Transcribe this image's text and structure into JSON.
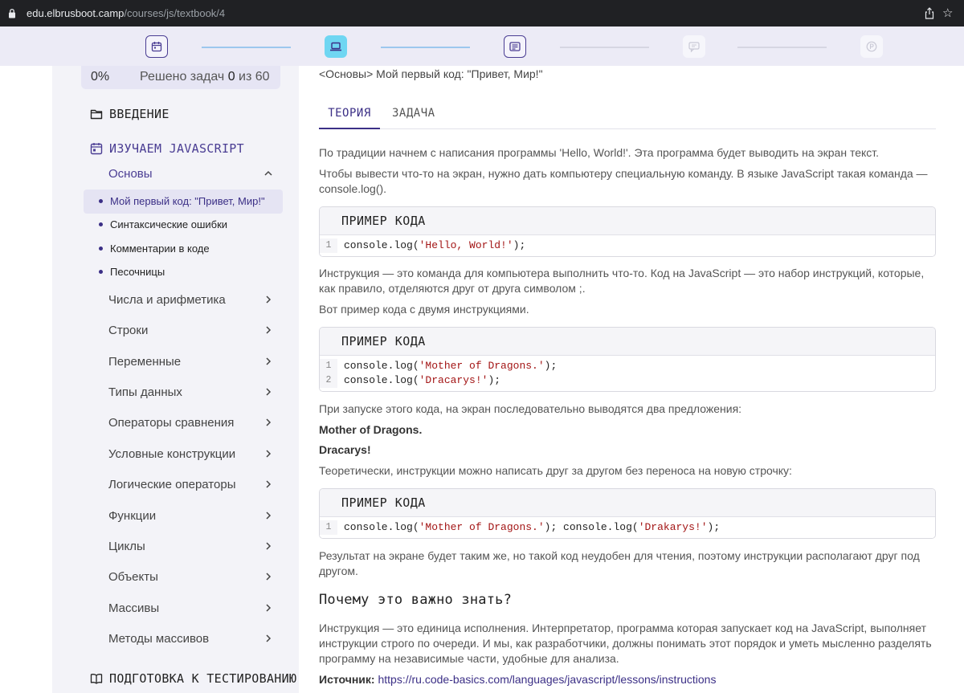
{
  "browser": {
    "url_domain": "edu.elbrusboot.camp",
    "url_path": "/courses/js/textbook/4"
  },
  "stepper": {
    "steps": [
      {
        "icon": "calendar-icon",
        "state": "done"
      },
      {
        "icon": "laptop-icon",
        "state": "active"
      },
      {
        "icon": "card-icon",
        "state": "done"
      },
      {
        "icon": "chat-icon",
        "state": "todo"
      },
      {
        "icon": "coin-icon",
        "state": "todo"
      }
    ]
  },
  "sidebar": {
    "progress": {
      "percent": "0%",
      "solved_label": "Решено задач",
      "solved_count": "0",
      "of_label": "из",
      "total": "60"
    },
    "sections": {
      "intro": "ВВЕДЕНИЕ",
      "learn_js": "ИЗУЧАЕМ JAVASCRIPT",
      "testing": "ПОДГОТОВКА К ТЕСТИРОВАНИЮ"
    },
    "current_topic": "Основы",
    "lessons": [
      "Мой первый код: \"Привет, Мир!\"",
      "Синтаксические ошибки",
      "Комментарии в коде",
      "Песочницы"
    ],
    "topics": [
      "Числа и арифметика",
      "Строки",
      "Переменные",
      "Типы данных",
      "Операторы сравнения",
      "Условные конструкции",
      "Логические операторы",
      "Функции",
      "Циклы",
      "Объекты",
      "Массивы",
      "Методы массивов"
    ]
  },
  "main": {
    "breadcrumb": "<Основы> Мой первый код: \"Привет, Мир!\"",
    "tabs": {
      "theory": "ТЕОРИЯ",
      "task": "ЗАДАЧА"
    },
    "p1": "По традиции начнем с написания программы 'Hello, World!'. Эта программа будет выводить на экран текст.",
    "p2": "Чтобы вывести что-то на экран, нужно дать компьютеру специальную команду. В языке JavaScript такая команда — console.log().",
    "code_header": "ПРИМЕР КОДА",
    "code1": [
      {
        "n": "1",
        "pre": "console.log(",
        "str": "'Hello, World!'",
        "post": ");"
      }
    ],
    "p3": "Инструкция — это команда для компьютера выполнить что-то. Код на JavaScript — это набор инструкций, которые, как правило, отделяются друг от друга символом ;.",
    "p4": "Вот пример кода с двумя инструкциями.",
    "code2": [
      {
        "n": "1",
        "pre": "console.log(",
        "str": "'Mother of Dragons.'",
        "post": ");"
      },
      {
        "n": "2",
        "pre": "console.log(",
        "str": "'Dracarys!'",
        "post": ");"
      }
    ],
    "p5": "При запуске этого кода, на экран последовательно выводятся два предложения:",
    "out1": "Mother of Dragons.",
    "out2": "Dracarys!",
    "p6": "Теоретически, инструкции можно написать друг за другом без переноса на новую строчку:",
    "code3": [
      {
        "n": "1",
        "pre": "console.log(",
        "str": "'Mother of Dragons.'",
        "mid": "); console.log(",
        "str2": "'Drakarys!'",
        "post": ");"
      }
    ],
    "p7": "Результат на экране будет таким же, но такой код неудобен для чтения, поэтому инструкции располагают друг под другом.",
    "h_why": "Почему это важно знать?",
    "p8": "Инструкция — это единица исполнения. Интерпретатор, программа которая запускает код на JavaScript, выполняет инструкции строго по очереди. И мы, как разработчики, должны понимать этот порядок и уметь мысленно разделять программу на независимые части, удобные для анализа.",
    "source_label": "Источник:",
    "source_url": "https://ru.code-basics.com/languages/javascript/lessons/instructions"
  }
}
